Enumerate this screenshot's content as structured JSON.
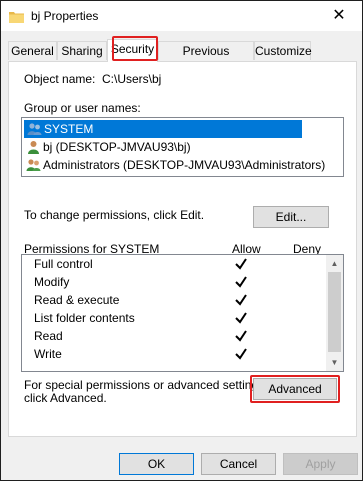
{
  "window": {
    "title": "bj Properties",
    "close_glyph": "✕"
  },
  "tabs": [
    {
      "label": "General"
    },
    {
      "label": "Sharing"
    },
    {
      "label": "Security"
    },
    {
      "label": "Previous Versions"
    },
    {
      "label": "Customize"
    }
  ],
  "security": {
    "object_label": "Object name:",
    "object_value": "C:\\Users\\bj",
    "groups_label": "Group or user names:",
    "groups": [
      {
        "name": "SYSTEM",
        "icon": "users-group-icon"
      },
      {
        "name": "bj (DESKTOP-JMVAU93\\bj)",
        "icon": "user-icon"
      },
      {
        "name": "Administrators (DESKTOP-JMVAU93\\Administrators)",
        "icon": "users-group-icon"
      }
    ],
    "change_text": "To change permissions, click Edit.",
    "edit_label": "Edit...",
    "perms_header": "Permissions for SYSTEM",
    "allow_header": "Allow",
    "deny_header": "Deny",
    "permissions": [
      {
        "name": "Full control",
        "allow": true,
        "deny": false
      },
      {
        "name": "Modify",
        "allow": true,
        "deny": false
      },
      {
        "name": "Read & execute",
        "allow": true,
        "deny": false
      },
      {
        "name": "List folder contents",
        "allow": true,
        "deny": false
      },
      {
        "name": "Read",
        "allow": true,
        "deny": false
      },
      {
        "name": "Write",
        "allow": true,
        "deny": false
      }
    ],
    "advanced_text_1": "For special permissions or advanced settings,",
    "advanced_text_2": "click Advanced.",
    "advanced_label": "Advanced"
  },
  "footer": {
    "ok": "OK",
    "cancel": "Cancel",
    "apply": "Apply"
  },
  "colors": {
    "selection": "#0078d7",
    "highlight": "#e02020"
  }
}
